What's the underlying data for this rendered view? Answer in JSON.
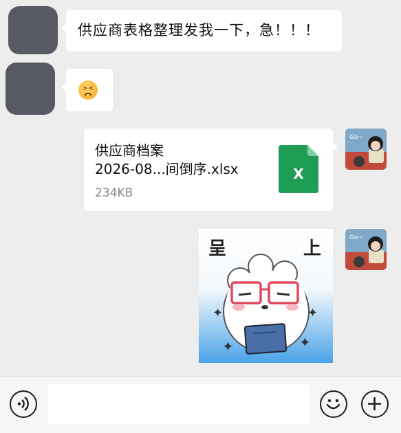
{
  "messages": [
    {
      "side": "left",
      "type": "text",
      "text": "供应商表格整理发我一下，急！！！"
    },
    {
      "side": "left",
      "type": "emoji",
      "emoji": "tired-face-emoji"
    },
    {
      "side": "right",
      "type": "file",
      "file_title": "供应商档案",
      "file_subtitle": "2026-08...间倒序.xlsx",
      "file_size": "234KB",
      "file_icon": "excel-icon"
    },
    {
      "side": "right",
      "type": "sticker",
      "sticker_left_char": "呈",
      "sticker_right_char": "上"
    }
  ],
  "input_bar": {
    "voice_icon": "voice-icon",
    "emoji_icon": "smile-icon",
    "add_icon": "plus-icon",
    "input_value": ""
  },
  "colors": {
    "chat_bg": "#ededed",
    "bubble": "#ffffff",
    "placeholder_avatar": "#575a63",
    "excel_green": "#1f9d55",
    "sticker_sky": "#4aa3e8"
  }
}
